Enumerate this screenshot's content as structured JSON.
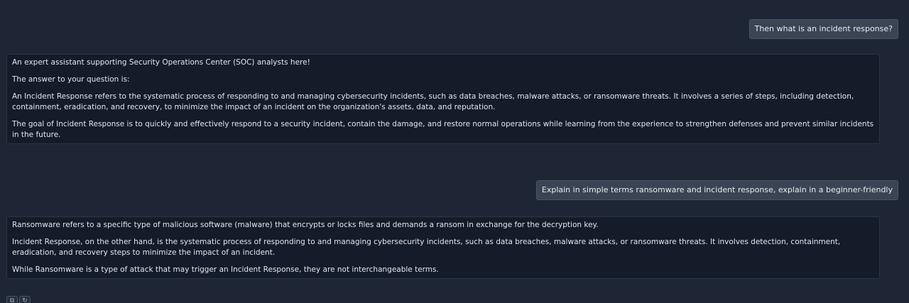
{
  "conversation": {
    "user_1": "Then what is an incident response?",
    "assistant_1": [
      "An expert assistant supporting Security Operations Center (SOC) analysts here!",
      "The answer to your question is:",
      "An Incident Response refers to the systematic process of responding to and managing cybersecurity incidents, such as data breaches, malware attacks, or ransomware threats. It involves a series of steps, including detection, containment, eradication, and recovery, to minimize the impact of an incident on the organization's assets, data, and reputation.",
      "The goal of Incident Response is to quickly and effectively respond to a security incident, contain the damage, and restore normal operations while learning from the experience to strengthen defenses and prevent similar incidents in the future."
    ],
    "user_2": "Explain in simple terms ransomware and incident response, explain in a beginner-friendly",
    "assistant_2": [
      "Ransomware refers to a specific type of malicious software (malware) that encrypts or locks files and demands a ransom in exchange for the decryption key.",
      "Incident Response, on the other hand, is the systematic process of responding to and managing cybersecurity incidents, such as data breaches, malware attacks, or ransomware threats. It involves detection, containment, eradication, and recovery steps to minimize the impact of an incident.",
      "While Ransomware is a type of attack that may trigger an Incident Response, they are not interchangeable terms."
    ]
  },
  "actions": {
    "copy_icon": "copy-icon",
    "regenerate_icon": "refresh-icon"
  },
  "colors": {
    "background": "#1e2635",
    "user_bubble": "#3a4454",
    "assistant_bubble": "#141b29"
  }
}
